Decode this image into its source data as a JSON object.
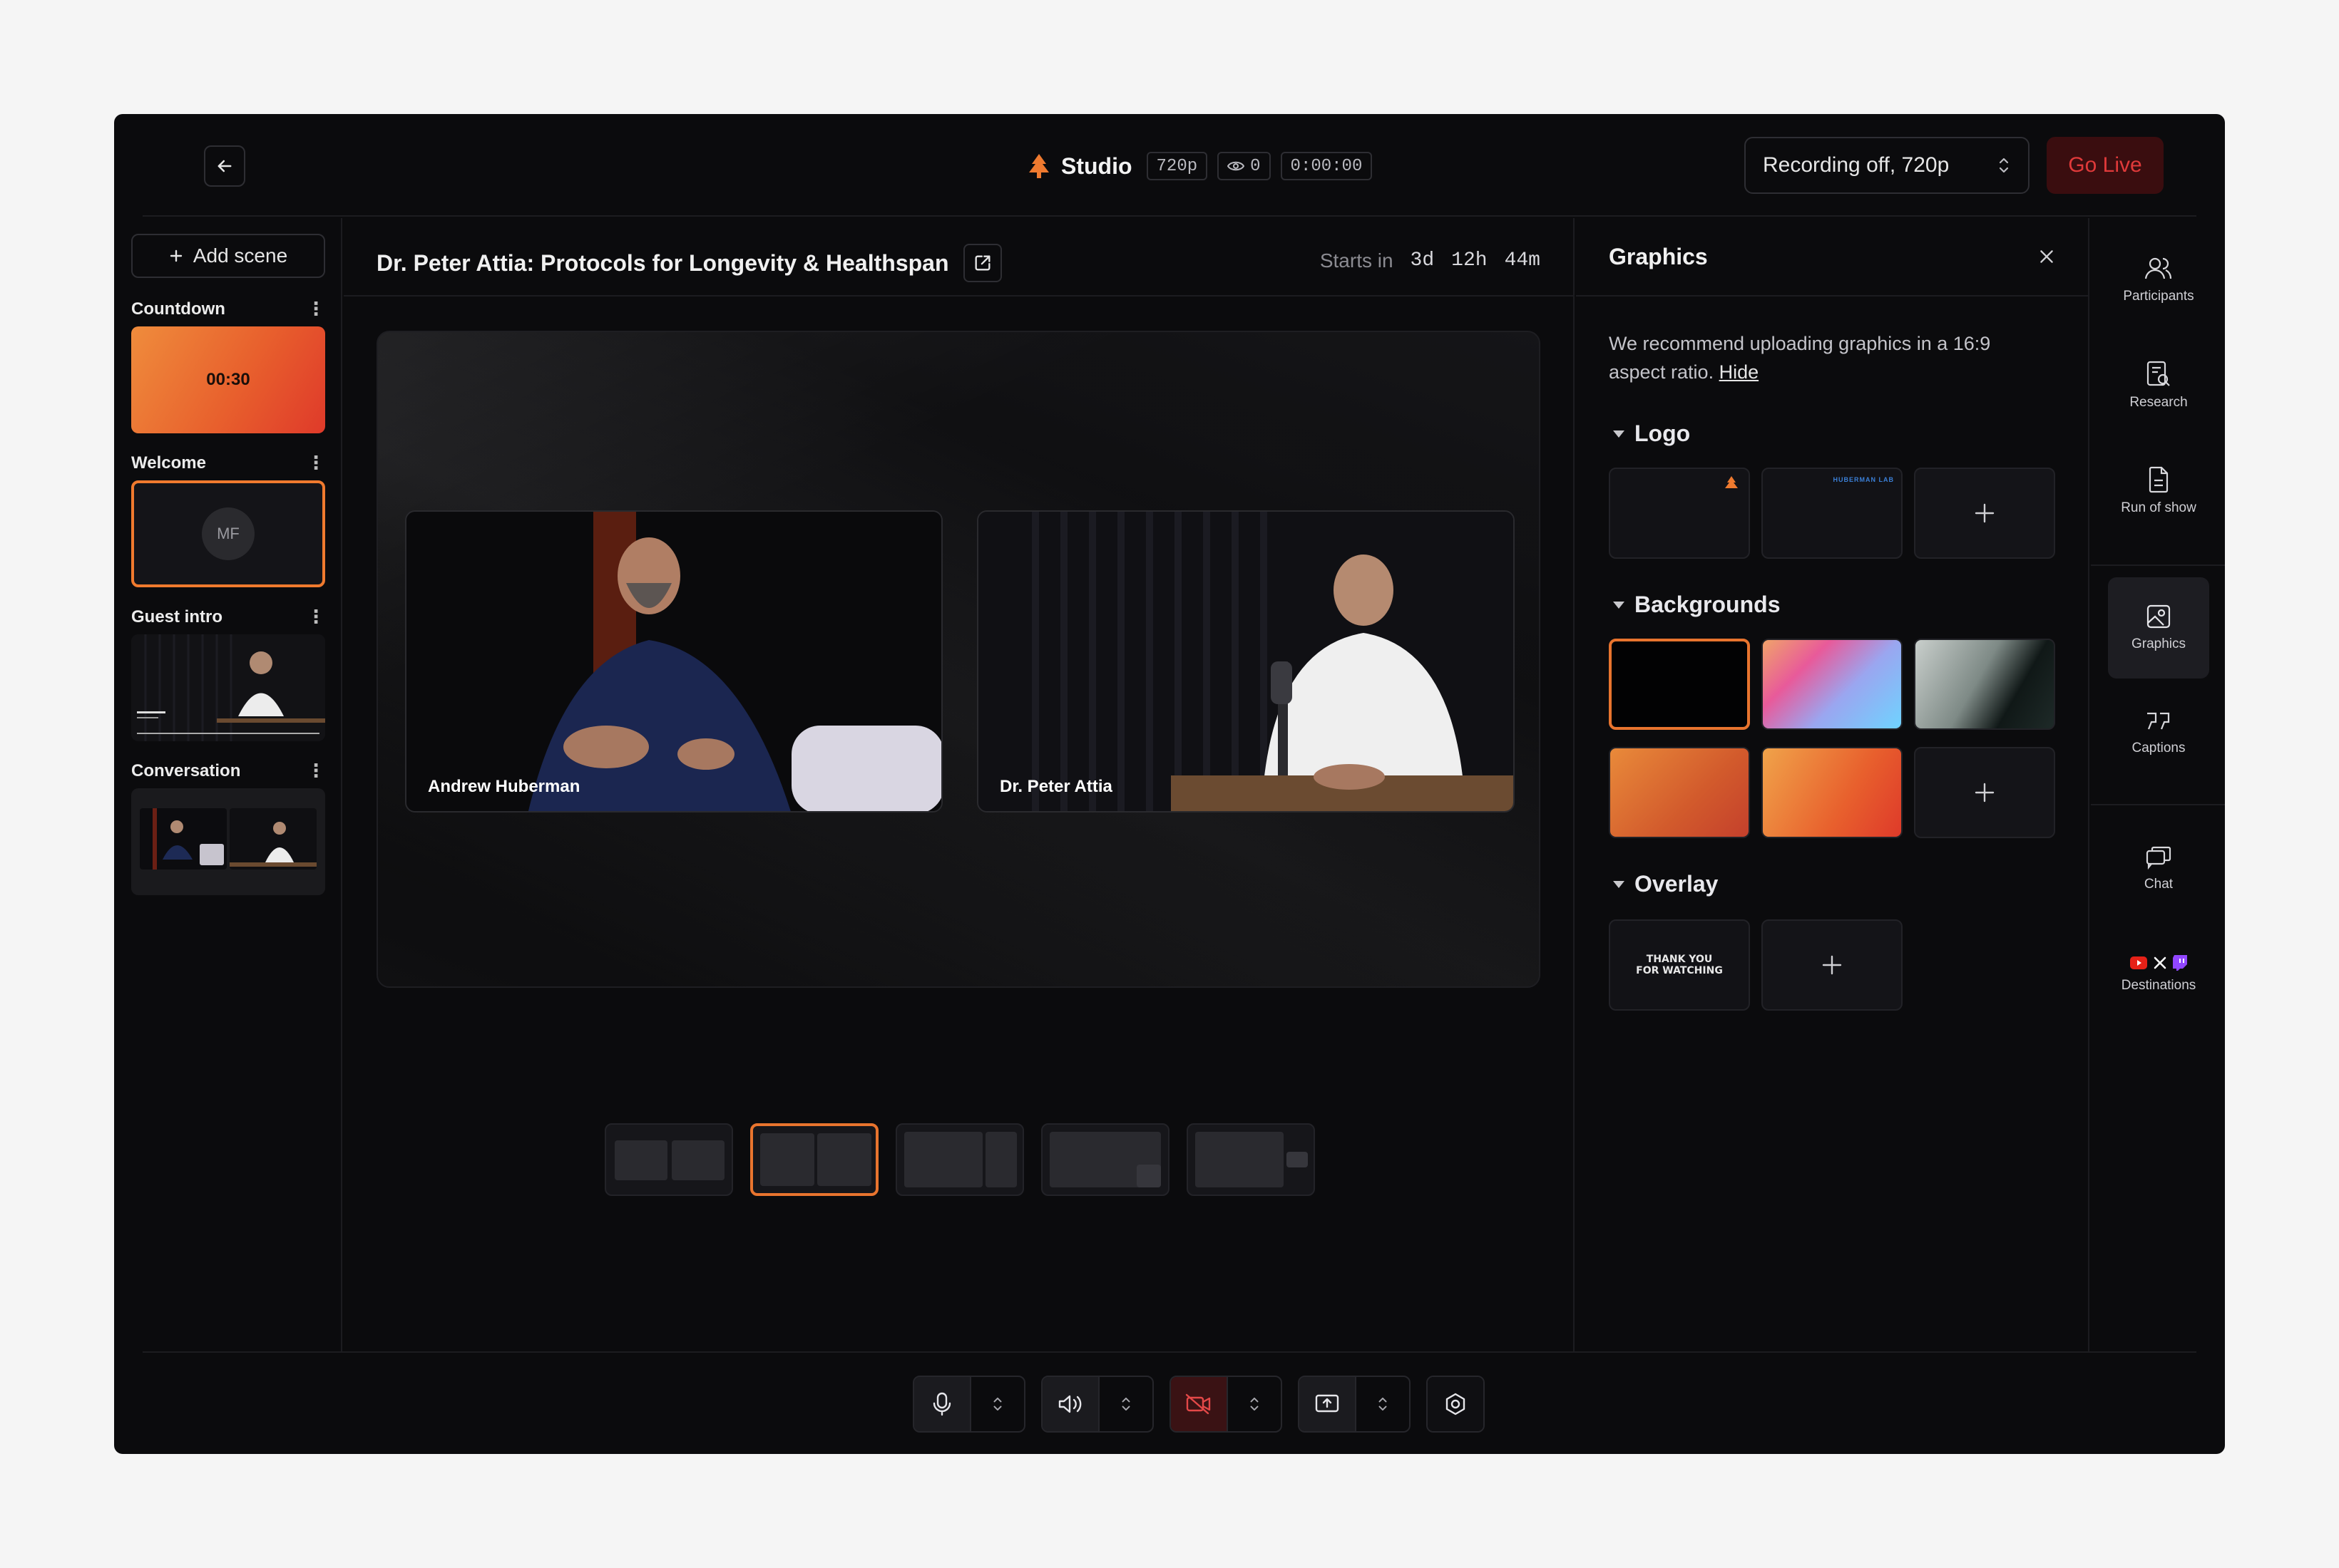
{
  "topbar": {
    "brand": "Studio",
    "resolution": "720p",
    "viewers": "0",
    "timer": "0:00:00",
    "recording_select": "Recording off, 720p",
    "go_live": "Go Live"
  },
  "scenes": {
    "add_label": "Add scene",
    "items": [
      {
        "label": "Countdown",
        "content": "00:30"
      },
      {
        "label": "Welcome",
        "content": "MF"
      },
      {
        "label": "Guest intro",
        "content": ""
      },
      {
        "label": "Conversation",
        "content": ""
      }
    ]
  },
  "show": {
    "title": "Dr. Peter Attia: Protocols for Longevity & Healthspan",
    "starts_label": "Starts in",
    "starts_days": "3d",
    "starts_hours": "12h",
    "starts_minutes": "44m"
  },
  "stage": {
    "participants": [
      {
        "name": "Andrew Huberman"
      },
      {
        "name": "Dr. Peter Attia"
      }
    ]
  },
  "graphics": {
    "title": "Graphics",
    "note": "We recommend uploading graphics in a 16:9 aspect ratio.",
    "hide_link": "Hide",
    "sections": {
      "logo": "Logo",
      "backgrounds": "Backgrounds",
      "overlay": "Overlay"
    },
    "overlay_text_line1": "THANK YOU",
    "overlay_text_line2": "FOR WATCHING",
    "logo_text": "HUBERMAN LAB"
  },
  "rail": {
    "items": [
      {
        "label": "Participants",
        "icon": "participants-icon"
      },
      {
        "label": "Research",
        "icon": "research-icon"
      },
      {
        "label": "Run of show",
        "icon": "run-of-show-icon"
      },
      {
        "label": "Graphics",
        "icon": "graphics-icon"
      },
      {
        "label": "Captions",
        "icon": "captions-icon"
      },
      {
        "label": "Chat",
        "icon": "chat-icon"
      },
      {
        "label": "Destinations",
        "icon": "destinations-icon"
      }
    ]
  },
  "colors": {
    "accent": "#e8742e",
    "danger": "#e03a3a",
    "background": "#0b0b0d"
  }
}
